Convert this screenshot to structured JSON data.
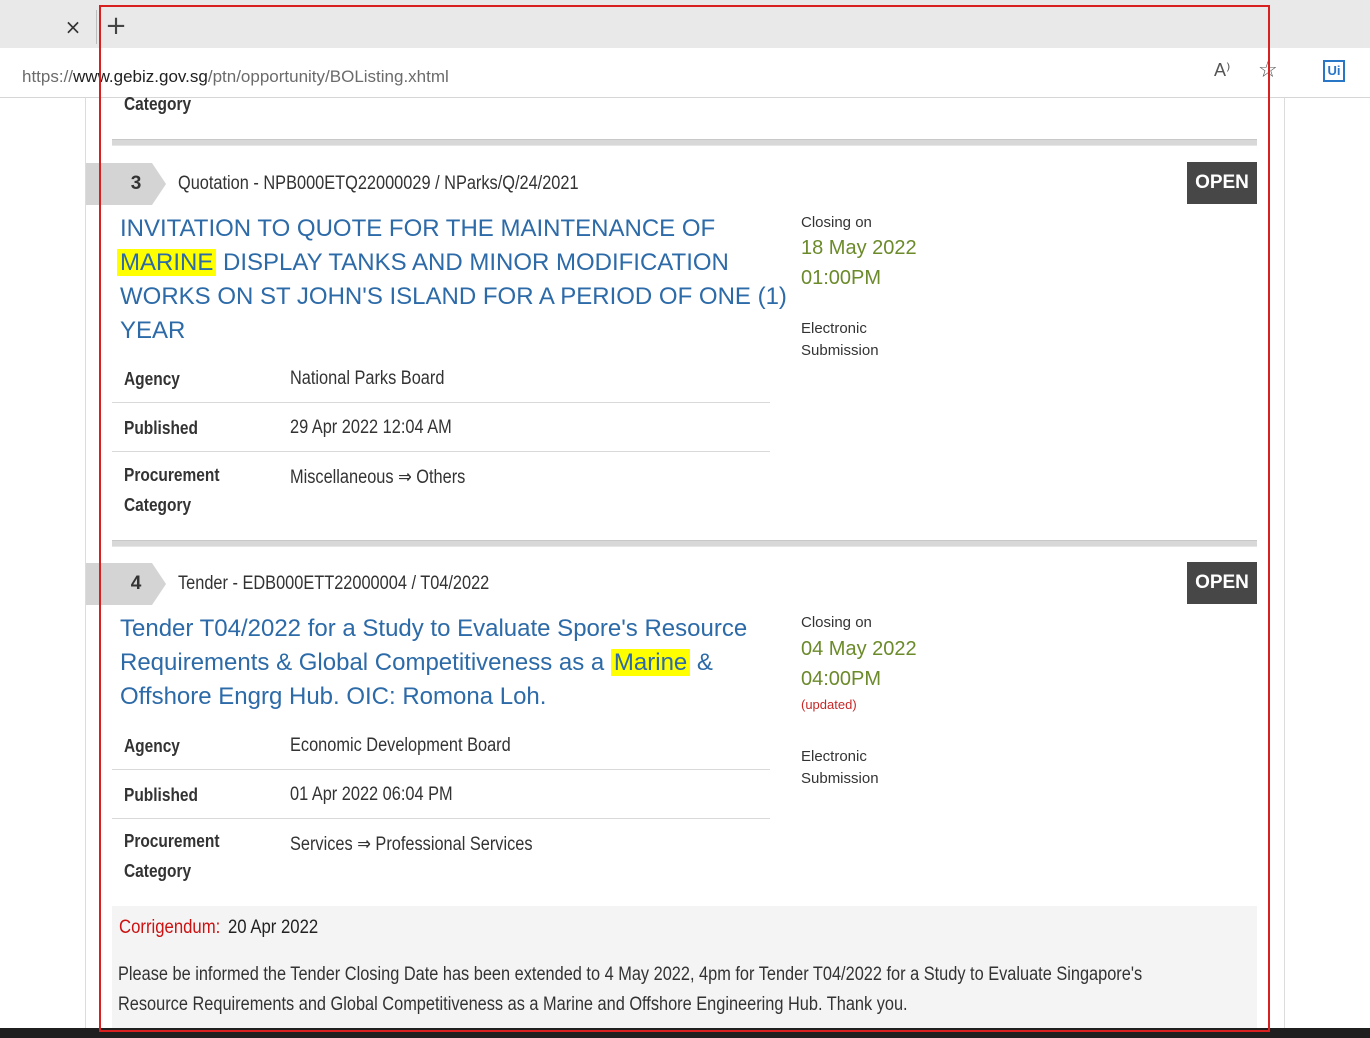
{
  "browser": {
    "tab_close": "×",
    "new_tab": "+",
    "url_prefix": "https://",
    "url_host": "www.gebiz.gov.sg",
    "url_path": "/ptn/opportunity/BOListing.xhtml",
    "read_aloud_icon": "A⁾",
    "favorites_icon": "☆",
    "extension_icon": "Ui"
  },
  "top_partial": {
    "label": "Category"
  },
  "listings": [
    {
      "number": "3",
      "reference": "Quotation - NPB000ETQ22000029 / NParks/Q/24/2021",
      "status": "OPEN",
      "title_line1": "INVITATION TO QUOTE FOR THE MAINTENANCE OF",
      "title_highlight": "MARINE",
      "title_line2_rest": " DISPLAY TANKS AND MINOR MODIFICATION",
      "title_line3": "WORKS ON ST JOHN'S ISLAND FOR A PERIOD OF ONE (1)",
      "title_line4": "YEAR",
      "closing_label": "Closing on",
      "closing_date": "18 May 2022",
      "closing_time": "01:00PM",
      "submission": "Electronic Submission",
      "agency_label": "Agency",
      "agency": "National Parks Board",
      "published_label": "Published",
      "published": "29 Apr 2022 12:04 AM",
      "procurement_label_1": "Procurement",
      "procurement_label_2": "Category",
      "procurement": "Miscellaneous ⇒ Others"
    },
    {
      "number": "4",
      "reference": "Tender - EDB000ETT22000004 / T04/2022",
      "status": "OPEN",
      "title_line1": "Tender T04/2022 for a Study to Evaluate Spore's Resource",
      "title_line2_pre": "Requirements & Global Competitiveness as a ",
      "title_highlight": "Marine",
      "title_line2_post": " &",
      "title_line3": "Offshore Engrg Hub. OIC: Romona Loh.",
      "closing_label": "Closing on",
      "closing_date": "04 May 2022",
      "closing_time": "04:00PM",
      "updated": "(updated)",
      "submission": "Electronic Submission",
      "agency_label": "Agency",
      "agency": "Economic Development Board",
      "published_label": "Published",
      "published": "01 Apr 2022 06:04 PM",
      "procurement_label_1": "Procurement",
      "procurement_label_2": "Category",
      "procurement": "Services ⇒ Professional Services",
      "corrigendum_label": "Corrigendum:",
      "corrigendum_date": "20 Apr 2022",
      "corrigendum_text": "Please be informed the Tender Closing Date has been extended to 4 May 2022, 4pm for Tender T04/2022 for a Study to Evaluate Singapore's Resource Requirements and Global Competitiveness as a Marine and Offshore Engineering Hub. Thank you."
    }
  ],
  "colors": {
    "title_blue": "#2c6aa8",
    "closing_green": "#6b8a2a",
    "highlight": "#ffff00",
    "status_bg": "#474747",
    "corrigendum_red": "#cc1111",
    "annotation_frame": "#d92020"
  }
}
